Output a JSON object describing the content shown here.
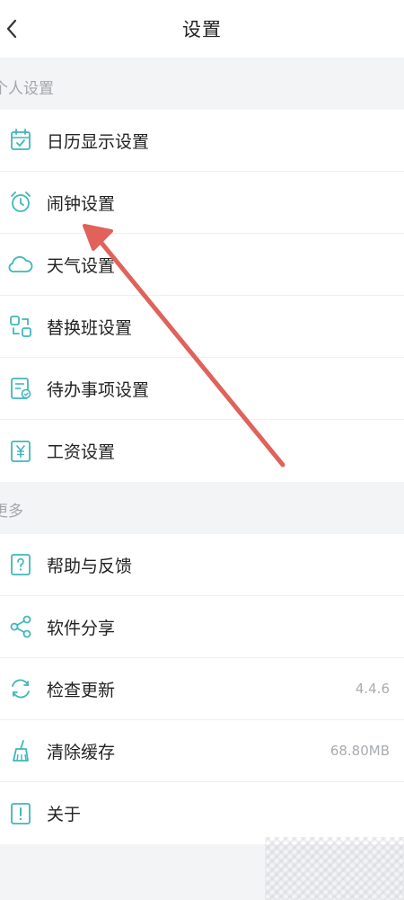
{
  "header": {
    "title": "设置"
  },
  "sections": {
    "personal": {
      "title": "个人设置",
      "items": [
        {
          "label": "日历显示设置",
          "icon": "calendar-icon"
        },
        {
          "label": "闹钟设置",
          "icon": "alarm-clock-icon"
        },
        {
          "label": "天气设置",
          "icon": "cloud-icon"
        },
        {
          "label": "替换班设置",
          "icon": "swap-shift-icon"
        },
        {
          "label": "待办事项设置",
          "icon": "todo-list-icon"
        },
        {
          "label": "工资设置",
          "icon": "salary-icon"
        }
      ]
    },
    "more": {
      "title": "更多",
      "items": [
        {
          "label": "帮助与反馈",
          "icon": "help-icon",
          "value": ""
        },
        {
          "label": "软件分享",
          "icon": "share-icon",
          "value": ""
        },
        {
          "label": "检查更新",
          "icon": "refresh-icon",
          "value": "4.4.6"
        },
        {
          "label": "清除缓存",
          "icon": "broom-icon",
          "value": "68.80MB"
        },
        {
          "label": "关于",
          "icon": "info-icon",
          "value": ""
        }
      ]
    }
  },
  "colors": {
    "accent": "#3fb7ba",
    "annotation_arrow": "#e0625a"
  }
}
